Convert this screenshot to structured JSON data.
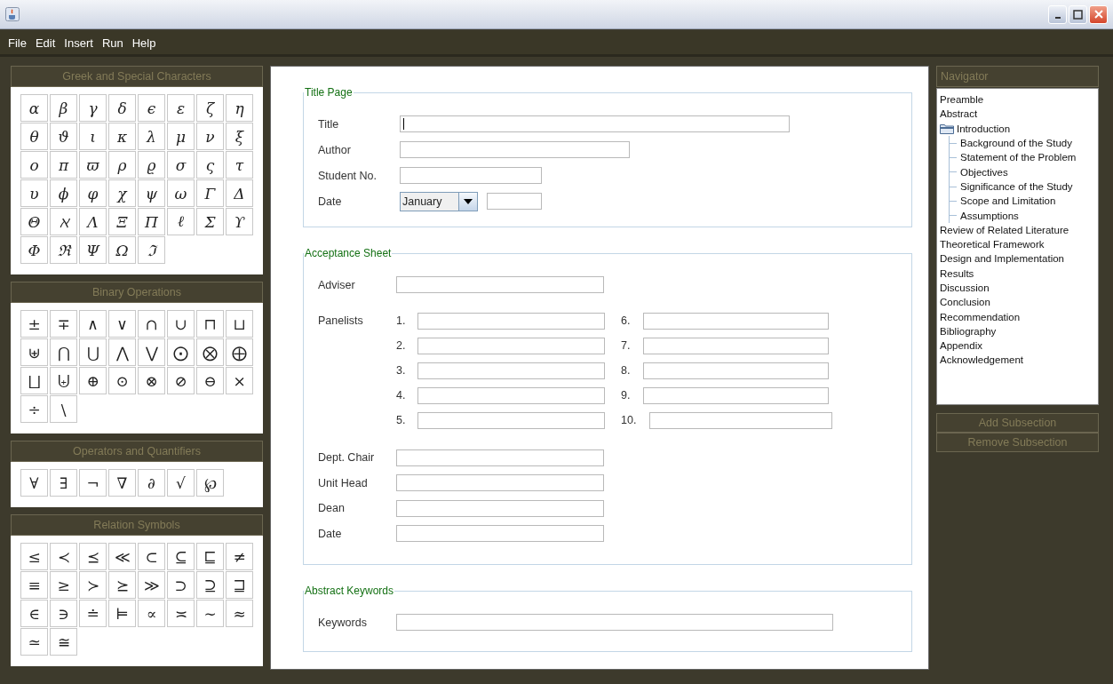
{
  "menu": [
    "File",
    "Edit",
    "Insert",
    "Run",
    "Help"
  ],
  "palettes": [
    {
      "title": "Greek and Special Characters",
      "symbols": [
        "α",
        "β",
        "γ",
        "δ",
        "ϵ",
        "ε",
        "ζ",
        "η",
        "θ",
        "ϑ",
        "ι",
        "κ",
        "λ",
        "μ",
        "ν",
        "ξ",
        "ο",
        "π",
        "ϖ",
        "ρ",
        "ϱ",
        "σ",
        "ς",
        "τ",
        "υ",
        "ϕ",
        "φ",
        "χ",
        "ψ",
        "ω",
        "Γ",
        "Δ",
        "Θ",
        "ℵ",
        "Λ",
        "Ξ",
        "Π",
        "ℓ",
        "Σ",
        "ϒ",
        "Φ",
        "ℜ",
        "Ψ",
        "Ω",
        "ℑ"
      ]
    },
    {
      "title": "Binary Operations",
      "symbols": [
        "±",
        "∓",
        "∧",
        "∨",
        "∩",
        "∪",
        "⊓",
        "⊔",
        "⊎",
        "⋂",
        "⋃",
        "⋀",
        "⋁",
        "⨀",
        "⨂",
        "⨁",
        "⨆",
        "⨄",
        "⊕",
        "⊙",
        "⊗",
        "⊘",
        "⊖",
        "×",
        "÷",
        "\\"
      ]
    },
    {
      "title": "Operators and Quantifiers",
      "symbols": [
        "∀",
        "∃",
        "¬",
        "∇",
        "∂",
        "√",
        "℘"
      ]
    },
    {
      "title": "Relation Symbols",
      "symbols": [
        "≤",
        "≺",
        "⪯",
        "≪",
        "⊂",
        "⊆",
        "⊑",
        "≠",
        "≡",
        "≥",
        "≻",
        "⪰",
        "≫",
        "⊃",
        "⊇",
        "⊒",
        "∈",
        "∋",
        "≐",
        "⊨",
        "∝",
        "≍",
        "∼",
        "≈",
        "≃",
        "≅"
      ]
    }
  ],
  "title_page": {
    "legend": "Title Page",
    "fields": [
      {
        "label": "Title",
        "kind": "text",
        "focused": true
      },
      {
        "label": "Author",
        "kind": "text",
        "focused": false
      },
      {
        "label": "Student No.",
        "kind": "text",
        "focused": false
      },
      {
        "label": "Date",
        "kind": "date",
        "value": "January",
        "focused": false
      }
    ]
  },
  "acceptance_sheet": {
    "legend": "Acceptance Sheet",
    "adviser": "Adviser",
    "panelists_label": "Panelists",
    "panelists": [
      "1.",
      "2.",
      "3.",
      "4.",
      "5.",
      "6.",
      "7.",
      "8.",
      "9.",
      "10."
    ],
    "signatories": [
      "Dept. Chair",
      "Unit Head",
      "Dean",
      "Date"
    ]
  },
  "abstract_keywords": {
    "legend": "Abstract Keywords",
    "label": "Keywords"
  },
  "navigator": {
    "title": "Navigator",
    "items": [
      {
        "label": "Preamble"
      },
      {
        "label": "Abstract"
      },
      {
        "label": "Introduction",
        "expanded": true,
        "children": [
          {
            "label": "Background of the Study"
          },
          {
            "label": "Statement of the Problem"
          },
          {
            "label": "Objectives"
          },
          {
            "label": "Significance of the Study"
          },
          {
            "label": "Scope and Limitation"
          },
          {
            "label": "Assumptions"
          }
        ]
      },
      {
        "label": "Review of Related Literature"
      },
      {
        "label": "Theoretical Framework"
      },
      {
        "label": "Design and Implementation"
      },
      {
        "label": "Results"
      },
      {
        "label": "Discussion"
      },
      {
        "label": "Conclusion"
      },
      {
        "label": "Recommendation"
      },
      {
        "label": "Bibliography"
      },
      {
        "label": "Appendix"
      },
      {
        "label": "Acknowledgement"
      }
    ]
  },
  "buttons": [
    "Add Subsection",
    "Remove Subsection"
  ]
}
